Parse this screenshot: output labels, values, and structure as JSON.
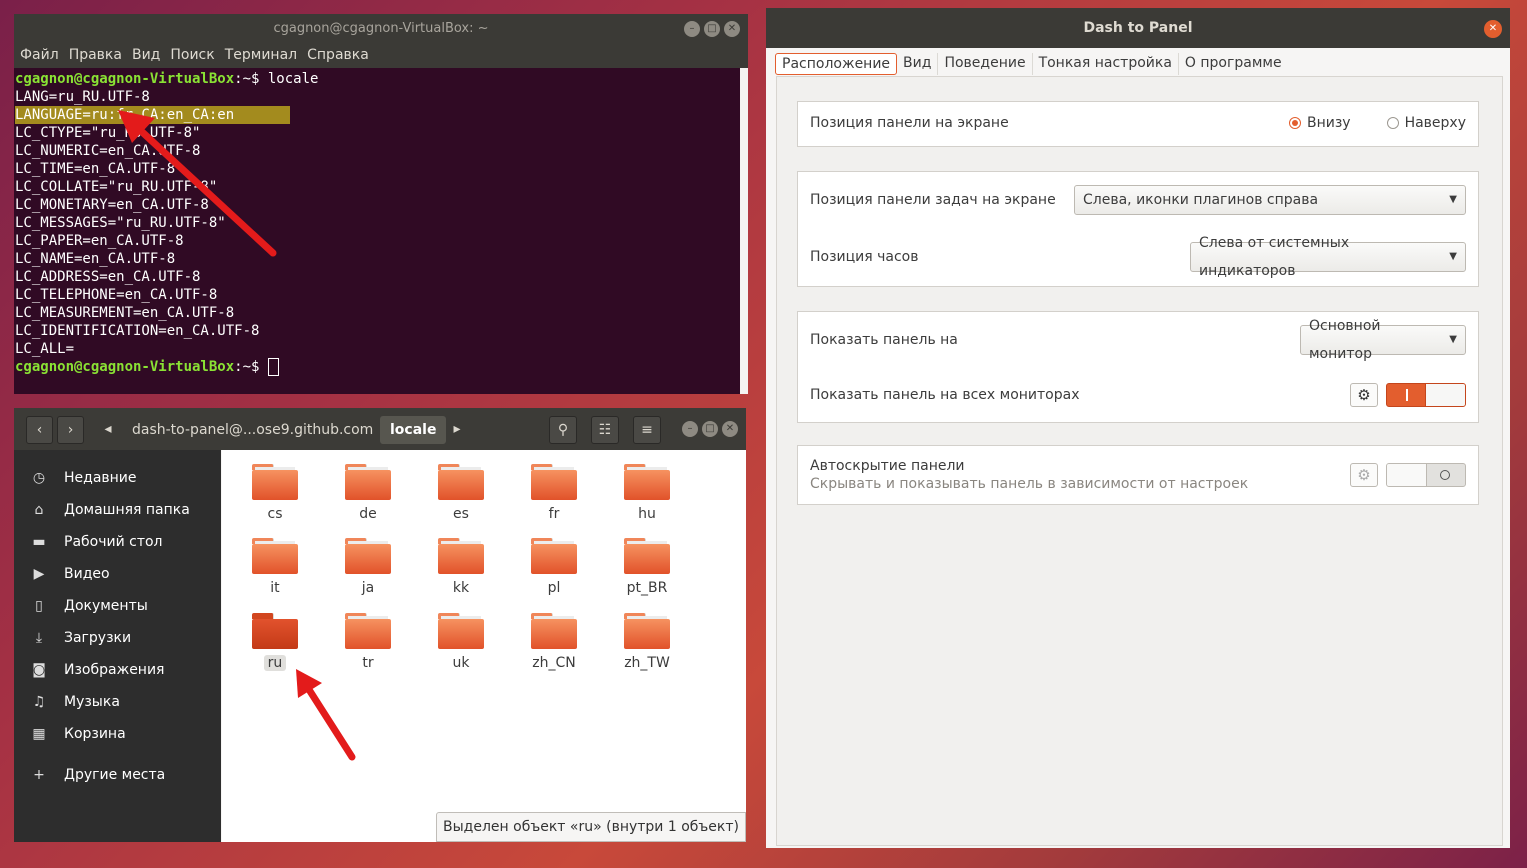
{
  "terminal": {
    "title": "cgagnon@cgagnon-VirtualBox: ~",
    "menu": [
      "Файл",
      "Правка",
      "Вид",
      "Поиск",
      "Терминал",
      "Справка"
    ],
    "prompt": "cgagnon@cgagnon-VirtualBox",
    "prompt_path": ":~$",
    "command": " locale",
    "lines": [
      "LANG=ru_RU.UTF-8",
      "LANGUAGE=ru:fr_CA:en_CA:en",
      "LC_CTYPE=\"ru_RU.UTF-8\"",
      "LC_NUMERIC=en_CA.UTF-8",
      "LC_TIME=en_CA.UTF-8",
      "LC_COLLATE=\"ru_RU.UTF-8\"",
      "LC_MONETARY=en_CA.UTF-8",
      "LC_MESSAGES=\"ru_RU.UTF-8\"",
      "LC_PAPER=en_CA.UTF-8",
      "LC_NAME=en_CA.UTF-8",
      "LC_ADDRESS=en_CA.UTF-8",
      "LC_TELEPHONE=en_CA.UTF-8",
      "LC_MEASUREMENT=en_CA.UTF-8",
      "LC_IDENTIFICATION=en_CA.UTF-8",
      "LC_ALL="
    ]
  },
  "files": {
    "breadcrumb": [
      "dash-to-panel@...ose9.github.com",
      "locale"
    ],
    "sidebar": [
      {
        "label": "Недавние",
        "icon": "clock-icon"
      },
      {
        "label": "Домашняя папка",
        "icon": "home-icon"
      },
      {
        "label": "Рабочий стол",
        "icon": "desktop-folder-icon"
      },
      {
        "label": "Видео",
        "icon": "video-icon"
      },
      {
        "label": "Документы",
        "icon": "document-icon"
      },
      {
        "label": "Загрузки",
        "icon": "download-icon"
      },
      {
        "label": "Изображения",
        "icon": "camera-icon"
      },
      {
        "label": "Музыка",
        "icon": "music-icon"
      },
      {
        "label": "Корзина",
        "icon": "trash-icon"
      },
      {
        "label": "Другие места",
        "icon": "plus-icon"
      }
    ],
    "folders": [
      "cs",
      "de",
      "es",
      "fr",
      "hu",
      "it",
      "ja",
      "kk",
      "pl",
      "pt_BR",
      "ru",
      "tr",
      "uk",
      "zh_CN",
      "zh_TW"
    ],
    "selected": "ru",
    "status": "Выделен объект «ru» (внутри 1 объект)"
  },
  "dash": {
    "title": "Dash to Panel",
    "tabs": [
      "Расположение",
      "Вид",
      "Поведение",
      "Тонкая настройка",
      "О программе"
    ],
    "panel_position_label": "Позиция панели на экране",
    "radio_bottom": "Внизу",
    "radio_top": "Наверху",
    "taskbar_position_label": "Позиция панели задач на экране",
    "taskbar_position_value": "Слева, иконки плагинов справа",
    "clock_position_label": "Позиция часов",
    "clock_position_value": "Слева от системных индикаторов",
    "show_on_label": "Показать панель на",
    "show_on_value": "Основной монитор",
    "all_monitors_label": "Показать панель на всех мониторах",
    "all_monitors_on": true,
    "autohide_label": "Автоскрытие панели",
    "autohide_sub": "Скрывать и показывать панель в зависимости от настроек",
    "autohide_on": false
  }
}
